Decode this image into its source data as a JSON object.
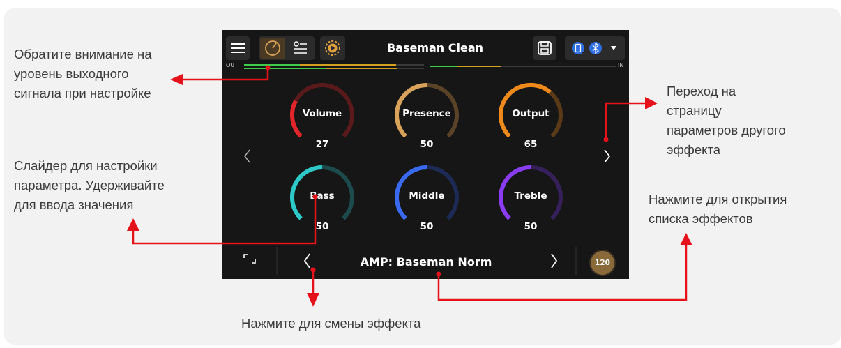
{
  "callouts": {
    "output_level": [
      "Обратите внимание на",
      "уровень выходного",
      "сигнала при настройке"
    ],
    "next_page": [
      "Переход на",
      "страницу",
      "параметров другого",
      "эффекта"
    ],
    "slider": [
      "Слайдер для настройки",
      "параметра. Удерживайте",
      "для ввода значения"
    ],
    "effect_list": [
      "Нажмите для открытия",
      "списка эффектов"
    ],
    "change_effect": "Нажмите для смены эффекта"
  },
  "device": {
    "preset_name": "Baseman Clean",
    "meter": {
      "out_label": "OUT",
      "in_label": "IN"
    },
    "effect_name": "AMP: Baseman Norm",
    "tempo": "120",
    "knobs": [
      {
        "label": "Volume",
        "value": "27",
        "fill": 0.27,
        "color": "#e0262b",
        "track": "#5a1a1c"
      },
      {
        "label": "Presence",
        "value": "50",
        "fill": 0.5,
        "color": "#d9a25a",
        "track": "#5a4327"
      },
      {
        "label": "Output",
        "value": "65",
        "fill": 0.65,
        "color": "#ee8a1c",
        "track": "#5a3a17"
      },
      {
        "label": "Bass",
        "value": "50",
        "fill": 0.5,
        "color": "#2fc8c8",
        "track": "#1d4a4c"
      },
      {
        "label": "Middle",
        "value": "50",
        "fill": 0.5,
        "color": "#3a6af0",
        "track": "#1d2a55"
      },
      {
        "label": "Treble",
        "value": "50",
        "fill": 0.5,
        "color": "#8a3cf0",
        "track": "#35205a"
      }
    ]
  },
  "colors": {
    "accent_red": "#e5121b",
    "bluetooth_blue": "#2f6de0"
  }
}
